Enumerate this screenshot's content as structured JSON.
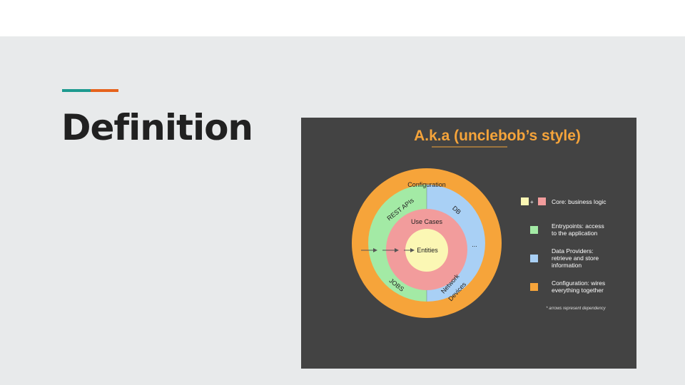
{
  "slide": {
    "title": "Definition"
  },
  "diagram": {
    "title": "A.k.a (unclebob’s style)",
    "rings": {
      "outer": "Configuration",
      "entrypoints_top": "REST APIs",
      "entrypoints_bottom": "JOBS",
      "providers_top": "DB",
      "providers_ellipsis": "...",
      "providers_bottom_line1": "Network",
      "providers_bottom_line2": "Devices",
      "use_cases": "Use Cases",
      "entities": "Entities"
    },
    "legend": [
      {
        "label_line1": "Core: business logic",
        "label_line2": "",
        "label_line3": ""
      },
      {
        "label_line1": "Entrypoints: access",
        "label_line2": "to the application",
        "label_line3": ""
      },
      {
        "label_line1": "Data Providers:",
        "label_line2": "retrieve and store",
        "label_line3": "information"
      },
      {
        "label_line1": "Configuration: wires",
        "label_line2": "everything together",
        "label_line3": ""
      }
    ],
    "legend_plus": "+",
    "footnote": "* arrows represent dependency",
    "colors": {
      "background": "#434343",
      "title": "#f6a43a",
      "configuration": "#f6a43a",
      "entrypoints": "#a3eaa5",
      "data_providers": "#a9d0f5",
      "use_cases": "#f29c9c",
      "entities": "#fbf7b4"
    }
  }
}
